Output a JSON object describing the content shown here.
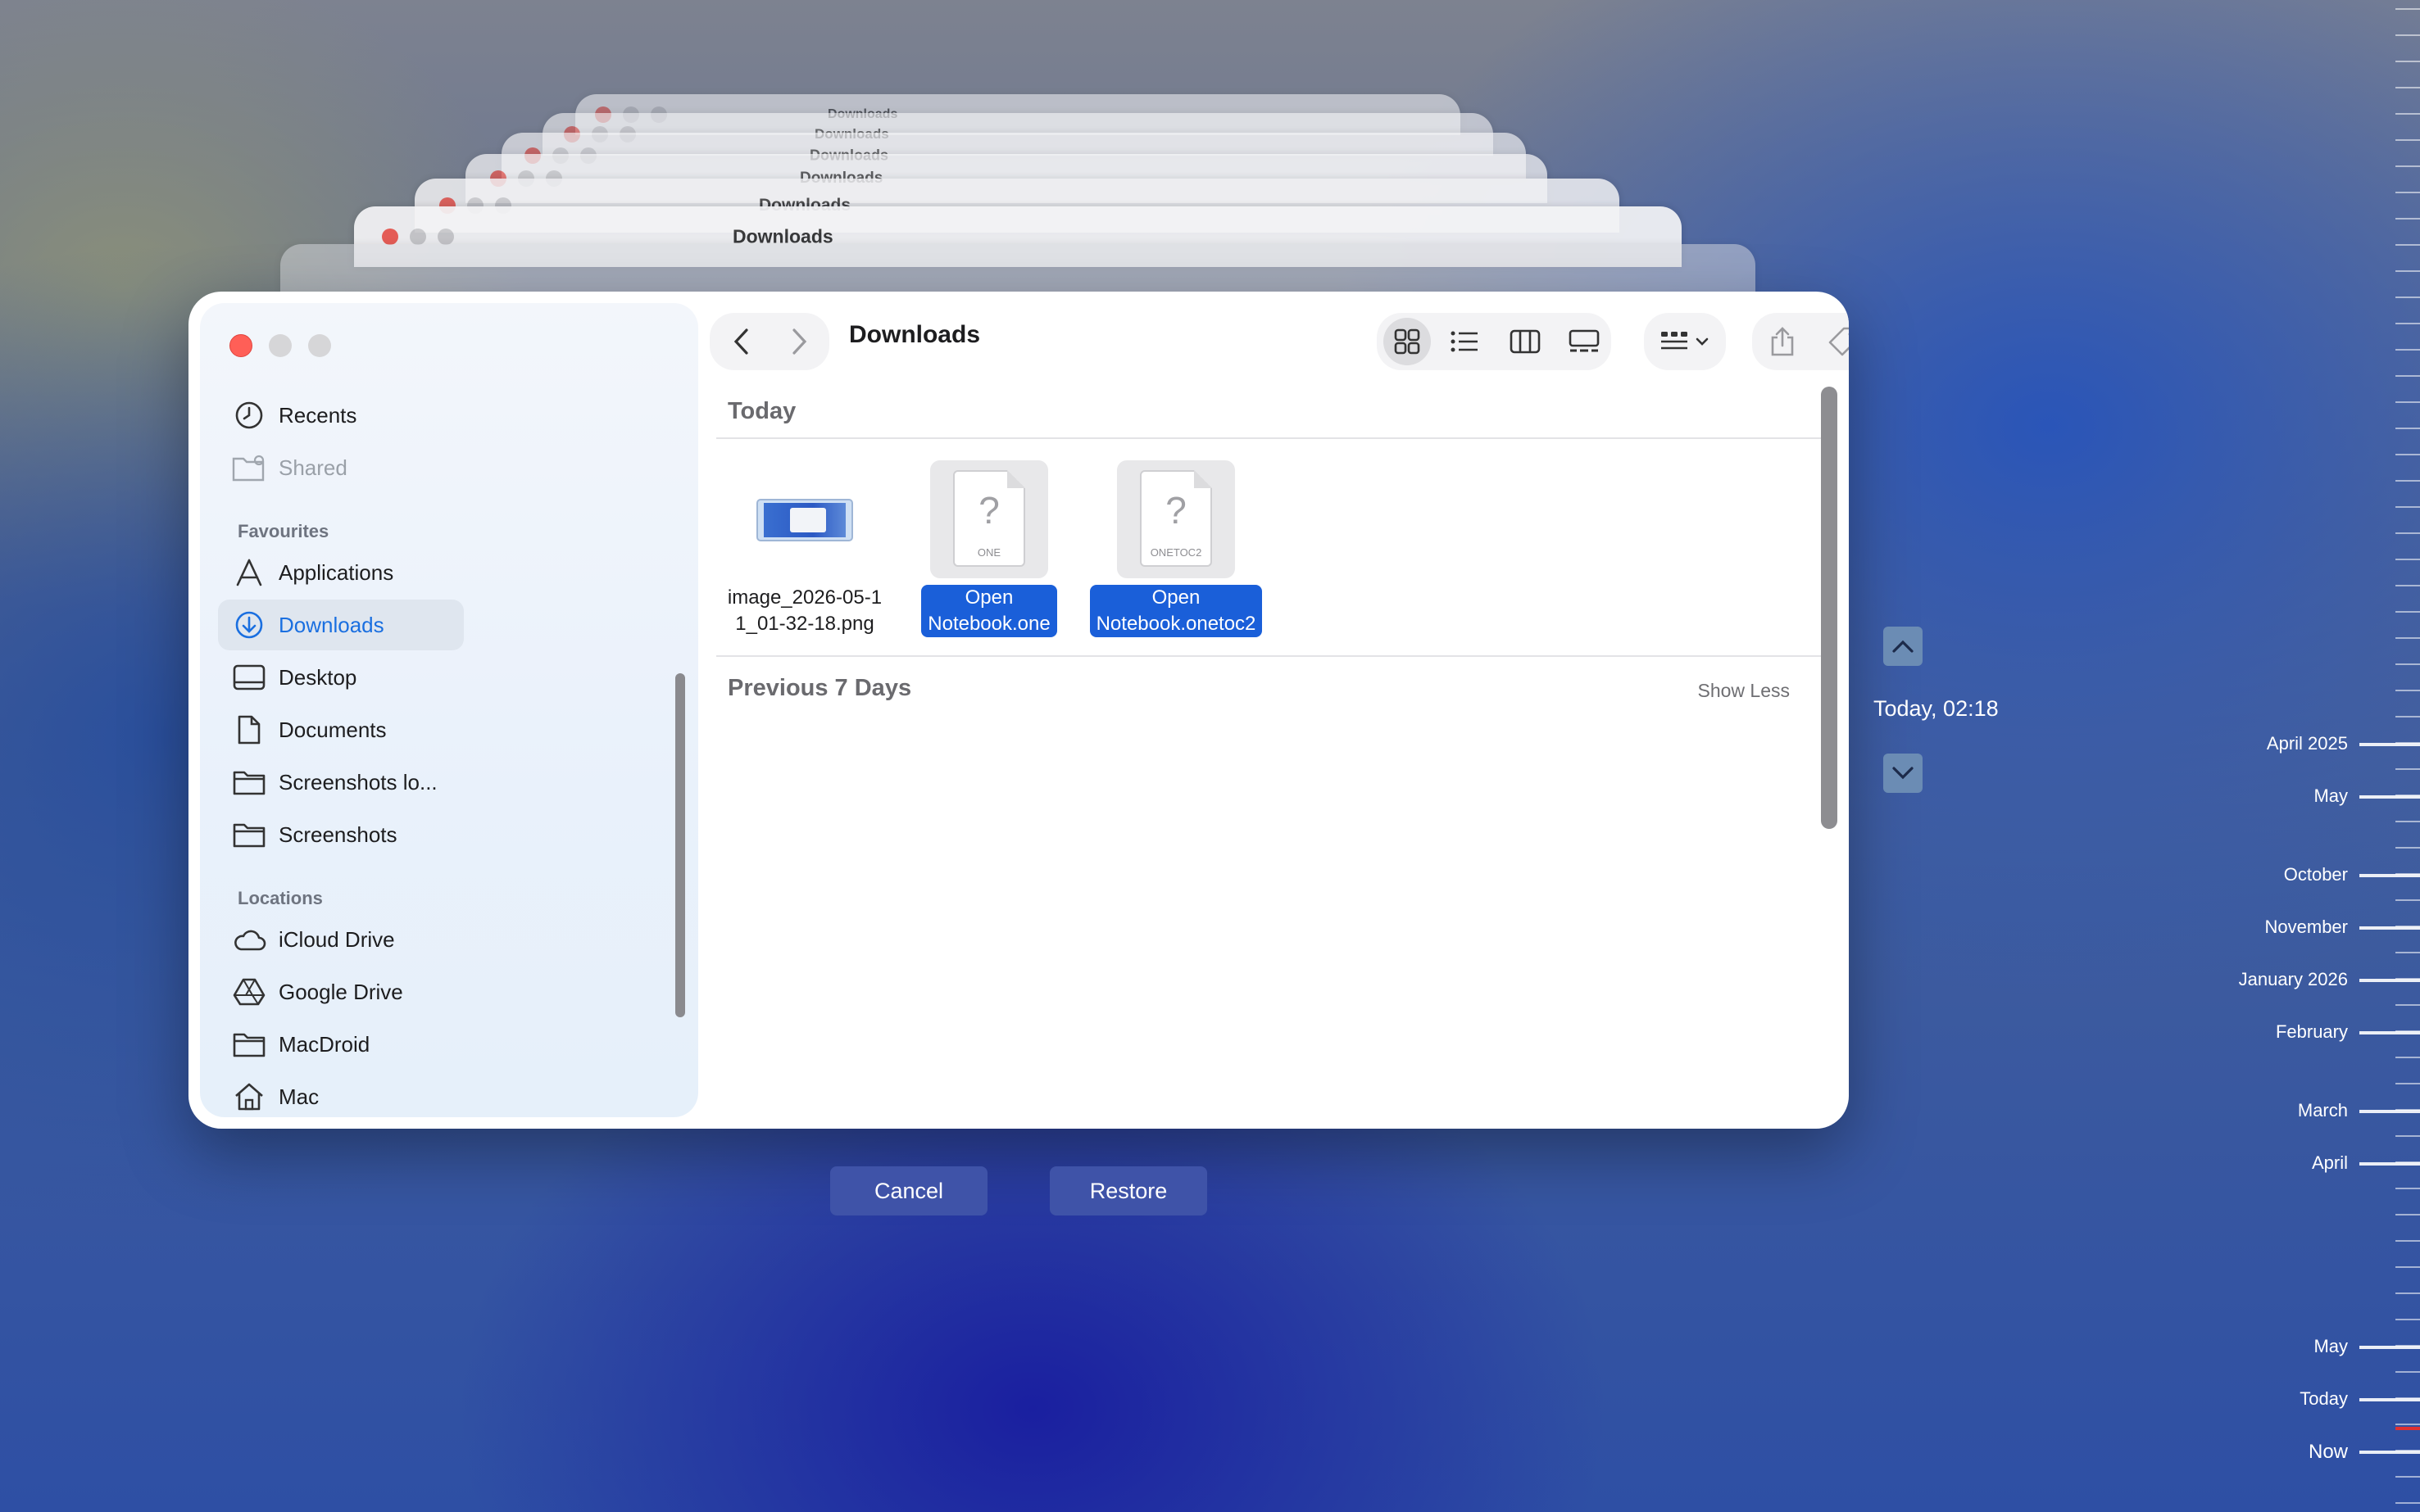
{
  "window": {
    "title": "Downloads",
    "colors": {
      "accent": "#1a6fe0",
      "selection": "#1a5fd9"
    }
  },
  "sidebar": {
    "items_top": [
      {
        "label": "Recents",
        "icon": "clock-icon"
      },
      {
        "label": "Shared",
        "icon": "shared-folder-icon"
      }
    ],
    "favourites_heading": "Favourites",
    "favourites": [
      {
        "label": "Applications",
        "icon": "applications-icon"
      },
      {
        "label": "Downloads",
        "icon": "download-circle-icon"
      },
      {
        "label": "Desktop",
        "icon": "desktop-icon"
      },
      {
        "label": "Documents",
        "icon": "document-icon"
      },
      {
        "label": "Screenshots lo...",
        "icon": "folder-icon"
      },
      {
        "label": "Screenshots",
        "icon": "folder-icon"
      }
    ],
    "locations_heading": "Locations",
    "locations": [
      {
        "label": "iCloud Drive",
        "icon": "cloud-icon"
      },
      {
        "label": "Google Drive",
        "icon": "google-drive-icon"
      },
      {
        "label": "MacDroid",
        "icon": "folder-icon"
      },
      {
        "label": "Mac",
        "icon": "home-icon"
      }
    ]
  },
  "content": {
    "today_heading": "Today",
    "files": [
      {
        "name_line1": "image_2026-05-1",
        "name_line2": "1_01-32-18.png",
        "kind": "image",
        "selected": false
      },
      {
        "name_line1": "Open",
        "name_line2": "Notebook.one",
        "kind": "document",
        "ext": "ONE",
        "selected": true
      },
      {
        "name_line1": "Open",
        "name_line2": "Notebook.onetoc2",
        "kind": "document",
        "ext": "ONETOC2",
        "selected": true
      }
    ],
    "previous_heading": "Previous 7 Days",
    "show_less": "Show Less"
  },
  "buttons": {
    "cancel": "Cancel",
    "restore": "Restore"
  },
  "time_machine": {
    "current_time": "Today, 02:18",
    "timeline_labels": [
      "April 2025",
      "May",
      "October",
      "November",
      "January 2026",
      "February",
      "March",
      "April",
      "May",
      "Today",
      "Now"
    ],
    "now_marker_color": "#e03030"
  }
}
